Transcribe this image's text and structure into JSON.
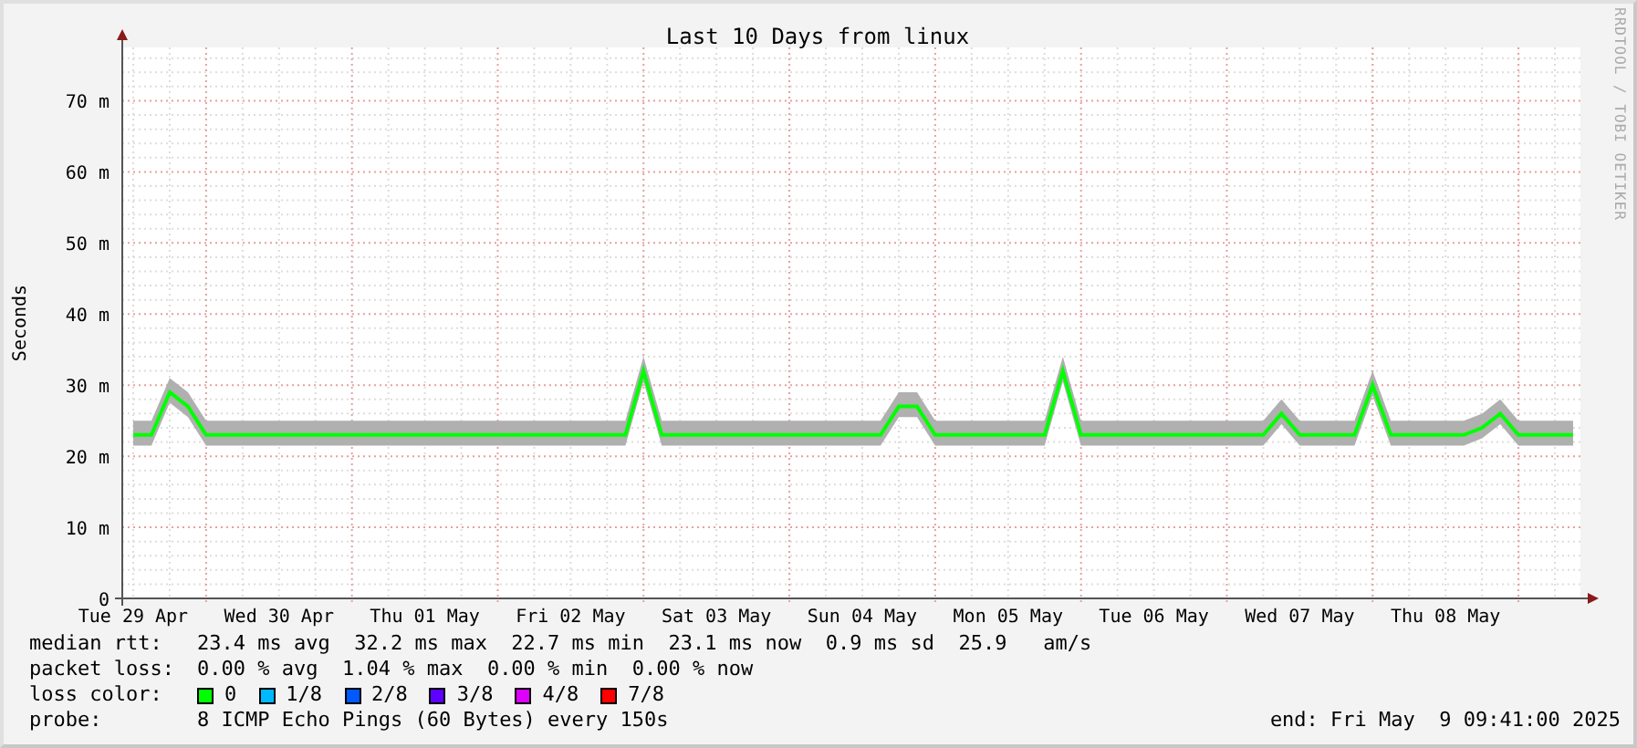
{
  "graph": {
    "title": "Last 10 Days from linux",
    "credit": "RRDTOOL / TOBI OETIKER",
    "chart_data": {
      "type": "line",
      "grid": true,
      "ylabel": "Seconds",
      "ylim": [
        0,
        77.5
      ],
      "yticks": [
        {
          "value": 0,
          "label": "0"
        },
        {
          "value": 10,
          "label": "10 m"
        },
        {
          "value": 20,
          "label": "20 m"
        },
        {
          "value": 30,
          "label": "30 m"
        },
        {
          "value": 40,
          "label": "40 m"
        },
        {
          "value": 50,
          "label": "50 m"
        },
        {
          "value": 60,
          "label": "60 m"
        },
        {
          "value": 70,
          "label": "70 m"
        }
      ],
      "categories": [
        "Tue 29 Apr",
        null,
        null,
        null,
        null,
        null,
        null,
        null,
        "Wed 30 Apr",
        null,
        null,
        null,
        null,
        null,
        null,
        null,
        "Thu 01 May",
        null,
        null,
        null,
        null,
        null,
        null,
        null,
        "Fri 02 May",
        null,
        null,
        null,
        null,
        null,
        null,
        null,
        "Sat 03 May",
        null,
        null,
        null,
        null,
        null,
        null,
        null,
        "Sun 04 May",
        null,
        null,
        null,
        null,
        null,
        null,
        null,
        "Mon 05 May",
        null,
        null,
        null,
        null,
        null,
        null,
        null,
        "Tue 06 May",
        null,
        null,
        null,
        null,
        null,
        null,
        null,
        "Wed 07 May",
        null,
        null,
        null,
        null,
        null,
        null,
        null,
        "Thu 08 May",
        null,
        null,
        null,
        null,
        null,
        null,
        null
      ],
      "series": [
        {
          "color": "#00ff00",
          "values": [
            23,
            23,
            29,
            27,
            23,
            23,
            23,
            23,
            23,
            23,
            23,
            23,
            23,
            23,
            23,
            23,
            23,
            23,
            23,
            23,
            23,
            23,
            23,
            23,
            23,
            23,
            23,
            23,
            32,
            23,
            23,
            23,
            23,
            23,
            23,
            23,
            23,
            23,
            23,
            23,
            23,
            23,
            27,
            27,
            23,
            23,
            23,
            23,
            23,
            23,
            23,
            32,
            23,
            23,
            23,
            23,
            23,
            23,
            23,
            23,
            23,
            23,
            23,
            26,
            23,
            23,
            23,
            23,
            30,
            23,
            23,
            23,
            23,
            23,
            24,
            26,
            23,
            23,
            23,
            23
          ]
        }
      ]
    }
  },
  "legend": {
    "stats": [
      {
        "label": "median rtt:",
        "text": "23.4 ms avg  32.2 ms max  22.7 ms min  23.1 ms now  0.9 ms sd  25.9   am/s"
      },
      {
        "label": "packet loss:",
        "text": "0.00 % avg  1.04 % max  0.00 % min  0.00 % now"
      }
    ],
    "loss_color": {
      "label": "loss color:",
      "items": [
        {
          "label": "0",
          "color": "#00ff00"
        },
        {
          "label": "1/8",
          "color": "#00b8ff"
        },
        {
          "label": "2/8",
          "color": "#0059ff"
        },
        {
          "label": "3/8",
          "color": "#5e00ff"
        },
        {
          "label": "4/8",
          "color": "#dd00ff"
        },
        {
          "label": "7/8",
          "color": "#ff0000"
        }
      ]
    },
    "probe": {
      "label": "probe:",
      "text": "8 ICMP Echo Pings (60 Bytes) every 150s"
    },
    "end": "end: Fri May  9 09:41:00 2025"
  }
}
